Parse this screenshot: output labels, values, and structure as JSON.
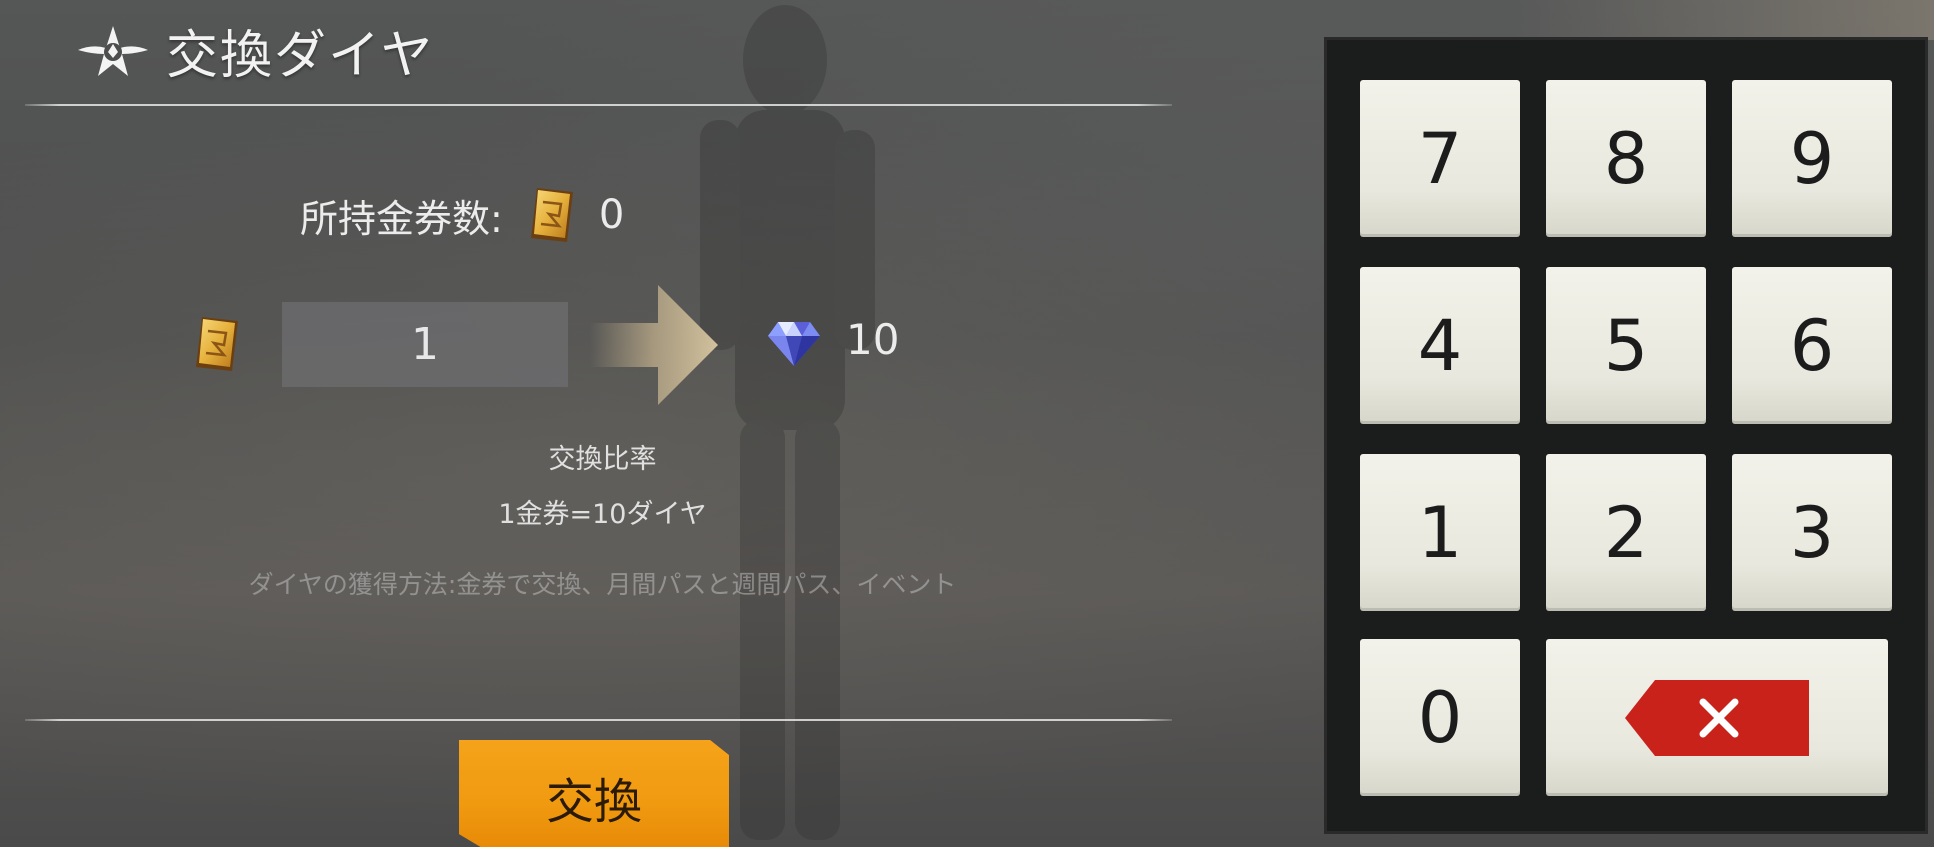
{
  "header": {
    "title": "交換ダイヤ",
    "logo_icon": "star-emblem-icon"
  },
  "balance": {
    "label": "所持金券数:",
    "count": "0",
    "icon": "gold-ticket-icon"
  },
  "exchange": {
    "input_value": "1",
    "input_icon": "gold-ticket-icon",
    "arrow_icon": "right-arrow-icon",
    "result_icon": "diamond-icon",
    "result_value": "10"
  },
  "rate": {
    "title": "交換比率",
    "value": "1金券=10ダイヤ"
  },
  "how_to_obtain": "ダイヤの獲得方法:金券で交換、月間パスと週間パス、イベント",
  "button": {
    "label": "交換"
  },
  "keypad": {
    "keys": [
      "7",
      "8",
      "9",
      "4",
      "5",
      "6",
      "1",
      "2",
      "3",
      "0"
    ],
    "backspace_icon": "backspace-icon"
  },
  "colors": {
    "accent_orange": "#f09a10",
    "backspace_red": "#c8221b",
    "key_face": "#ecece2",
    "keypad_bg": "#1b1c1c"
  }
}
